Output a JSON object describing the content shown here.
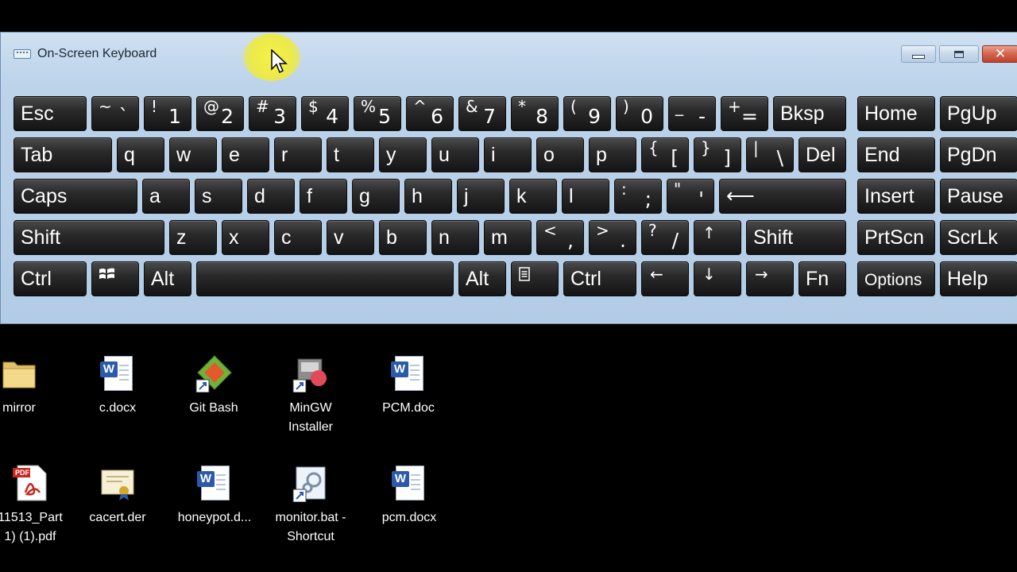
{
  "window": {
    "title": "On-Screen Keyboard",
    "minimize_label": "Minimize",
    "maximize_label": "Maximize",
    "close_label": "✕"
  },
  "keyboard": {
    "rows": [
      [
        {
          "name": "key-esc",
          "label": "Esc"
        },
        {
          "name": "key-backtick",
          "shift": "~",
          "low": "`"
        },
        {
          "name": "key-1",
          "shift": "!",
          "low": "1"
        },
        {
          "name": "key-2",
          "shift": "@",
          "low": "2"
        },
        {
          "name": "key-3",
          "shift": "#",
          "low": "3"
        },
        {
          "name": "key-4",
          "shift": "$",
          "low": "4"
        },
        {
          "name": "key-5",
          "shift": "%",
          "low": "5"
        },
        {
          "name": "key-6",
          "shift": "^",
          "low": "6"
        },
        {
          "name": "key-7",
          "shift": "&",
          "low": "7"
        },
        {
          "name": "key-8",
          "shift": "*",
          "low": "8"
        },
        {
          "name": "key-9",
          "shift": "(",
          "low": "9"
        },
        {
          "name": "key-0",
          "shift": ")",
          "low": "0"
        },
        {
          "name": "key-minus",
          "shift": "_",
          "low": "-"
        },
        {
          "name": "key-equals",
          "shift": "+",
          "low": "="
        },
        {
          "name": "key-backspace",
          "label": "Bksp"
        },
        {
          "name": "key-home",
          "label": "Home"
        },
        {
          "name": "key-pgup",
          "label": "PgUp"
        }
      ],
      [
        {
          "name": "key-tab",
          "label": "Tab"
        },
        {
          "name": "key-q",
          "label": "q"
        },
        {
          "name": "key-w",
          "label": "w"
        },
        {
          "name": "key-e",
          "label": "e"
        },
        {
          "name": "key-r",
          "label": "r"
        },
        {
          "name": "key-t",
          "label": "t"
        },
        {
          "name": "key-y",
          "label": "y"
        },
        {
          "name": "key-u",
          "label": "u"
        },
        {
          "name": "key-i",
          "label": "i"
        },
        {
          "name": "key-o",
          "label": "o"
        },
        {
          "name": "key-p",
          "label": "p"
        },
        {
          "name": "key-open-bracket",
          "shift": "{",
          "low": "["
        },
        {
          "name": "key-close-bracket",
          "shift": "}",
          "low": "]"
        },
        {
          "name": "key-backslash",
          "shift": "|",
          "low": "\\"
        },
        {
          "name": "key-del",
          "label": "Del"
        },
        {
          "name": "key-end",
          "label": "End"
        },
        {
          "name": "key-pgdn",
          "label": "PgDn"
        }
      ],
      [
        {
          "name": "key-caps",
          "label": "Caps"
        },
        {
          "name": "key-a",
          "label": "a"
        },
        {
          "name": "key-s",
          "label": "s"
        },
        {
          "name": "key-d",
          "label": "d"
        },
        {
          "name": "key-f",
          "label": "f"
        },
        {
          "name": "key-g",
          "label": "g"
        },
        {
          "name": "key-h",
          "label": "h"
        },
        {
          "name": "key-j",
          "label": "j"
        },
        {
          "name": "key-k",
          "label": "k"
        },
        {
          "name": "key-l",
          "label": "l"
        },
        {
          "name": "key-semicolon",
          "shift": ":",
          "low": ";"
        },
        {
          "name": "key-quote",
          "shift": "\"",
          "low": "'"
        },
        {
          "name": "key-enter",
          "label": "⟵"
        },
        {
          "name": "key-insert",
          "label": "Insert"
        },
        {
          "name": "key-pause",
          "label": "Pause"
        }
      ],
      [
        {
          "name": "key-shift-left",
          "label": "Shift"
        },
        {
          "name": "key-z",
          "label": "z"
        },
        {
          "name": "key-x",
          "label": "x"
        },
        {
          "name": "key-c",
          "label": "c"
        },
        {
          "name": "key-v",
          "label": "v"
        },
        {
          "name": "key-b",
          "label": "b"
        },
        {
          "name": "key-n",
          "label": "n"
        },
        {
          "name": "key-m",
          "label": "m"
        },
        {
          "name": "key-comma",
          "shift": "<",
          "low": ","
        },
        {
          "name": "key-period",
          "shift": ">",
          "low": "."
        },
        {
          "name": "key-slash",
          "shift": "?",
          "low": "/"
        },
        {
          "name": "key-up-arrow",
          "sym": "↑"
        },
        {
          "name": "key-shift-right",
          "label": "Shift"
        },
        {
          "name": "key-prtscn",
          "label": "PrtScn"
        },
        {
          "name": "key-scrlk",
          "label": "ScrLk"
        }
      ],
      [
        {
          "name": "key-ctrl-left",
          "label": "Ctrl"
        },
        {
          "name": "key-windows",
          "icon": "windows-icon"
        },
        {
          "name": "key-alt-left",
          "label": "Alt"
        },
        {
          "name": "key-space",
          "label": ""
        },
        {
          "name": "key-alt-right",
          "label": "Alt"
        },
        {
          "name": "key-menu",
          "icon": "menu-icon"
        },
        {
          "name": "key-ctrl-right",
          "label": "Ctrl"
        },
        {
          "name": "key-left-arrow",
          "sym": "←"
        },
        {
          "name": "key-down-arrow",
          "sym": "↓"
        },
        {
          "name": "key-right-arrow",
          "sym": "→"
        },
        {
          "name": "key-fn",
          "label": "Fn"
        },
        {
          "name": "key-options",
          "label": "Options",
          "small": true
        },
        {
          "name": "key-help",
          "label": "Help"
        }
      ]
    ]
  },
  "desktop": {
    "icons": [
      {
        "name": "mirror",
        "label": "mirror",
        "type": "folder"
      },
      {
        "name": "c-docx",
        "label": "c.docx",
        "type": "word"
      },
      {
        "name": "git-bash",
        "label": "Git Bash",
        "type": "gitbash"
      },
      {
        "name": "mingw-installer",
        "label": "MinGW\nInstaller",
        "type": "mingw"
      },
      {
        "name": "pcm-doc",
        "label": "PCM.doc",
        "type": "word"
      },
      {
        "name": "pdf-part",
        "label": "11513_Part\n1) (1).pdf",
        "type": "pdf"
      },
      {
        "name": "cacert-der",
        "label": "cacert.der",
        "type": "cert"
      },
      {
        "name": "honeypot-doc",
        "label": "honeypot.d...",
        "type": "word"
      },
      {
        "name": "monitor-bat",
        "label": "monitor.bat -\nShortcut",
        "type": "bat"
      },
      {
        "name": "pcm-docx",
        "label": "pcm.docx",
        "type": "word"
      }
    ]
  },
  "colors": {
    "window_frame": "#b3cce6",
    "key_face": "#1e1e1e",
    "key_text": "#ffffff",
    "close_button": "#c1402b",
    "desktop_bg": "#000000",
    "cursor_highlight": "#f5f24a"
  }
}
